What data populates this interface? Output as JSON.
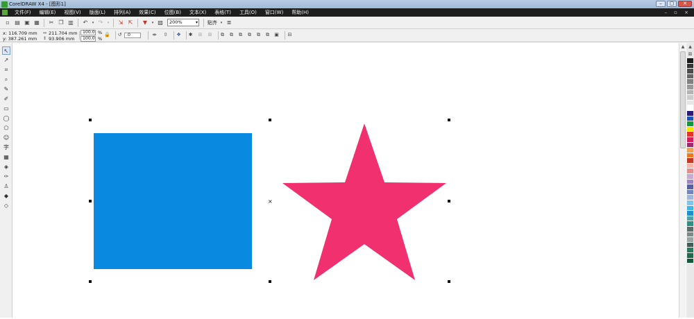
{
  "window": {
    "title": "CorelDRAW X4 - [图形1]",
    "buttons": [
      "–",
      "▢",
      "✕"
    ]
  },
  "menu": {
    "items": [
      "文件(F)",
      "编辑(E)",
      "视图(V)",
      "版面(L)",
      "排列(A)",
      "效果(C)",
      "位图(B)",
      "文本(X)",
      "表格(T)",
      "工具(O)",
      "窗口(W)",
      "帮助(H)"
    ]
  },
  "toolbar": {
    "zoom_value": "200%",
    "snap_label": "贴齐"
  },
  "properties": {
    "x": "x: 116.709 mm",
    "y": "y: 387.261 mm",
    "width": "211.704 mm",
    "height": "93.906 mm",
    "scale_x": "100.0",
    "scale_y": "100.0",
    "percent": "%",
    "rotation": ".0"
  },
  "colors": {
    "rectangle": "#0a89e1",
    "star": "#f0306f",
    "palette": [
      "#1a1a1a",
      "#333333",
      "#4d4d4d",
      "#666666",
      "#808080",
      "#999999",
      "#b3b3b3",
      "#cccccc",
      "#e6e6e6",
      "#ffffff",
      "#2b1a78",
      "#1d55b5",
      "#129a3a",
      "#f5e600",
      "#e7342a",
      "#d81e5b",
      "#a0286e",
      "#f2a14f",
      "#e97a21",
      "#c0392b",
      "#f5b5a8",
      "#e98c8c",
      "#c7a9d3",
      "#9b85c4",
      "#5a5fa3",
      "#6f86c2",
      "#9fb5dd",
      "#7fc6ea",
      "#42b4e6",
      "#1e8fc9",
      "#4aa3a8",
      "#2f8f86",
      "#5b6e6c",
      "#7d8a88",
      "#9aa5a3",
      "#3f5f58",
      "#2a7a5c",
      "#1f6a4a",
      "#0e5a3a"
    ]
  }
}
